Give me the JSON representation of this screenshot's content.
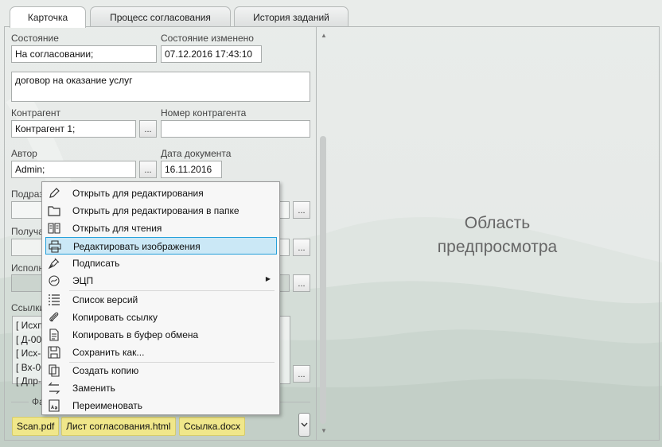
{
  "tabs": [
    {
      "label": "Карточка"
    },
    {
      "label": "Процесс согласования"
    },
    {
      "label": "История заданий"
    }
  ],
  "card": {
    "state": {
      "label": "Состояние",
      "value": "На согласовании;"
    },
    "state_changed": {
      "label": "Состояние изменено",
      "value": "07.12.2016  17:43:10"
    },
    "description": {
      "value": "договор на оказание услуг"
    },
    "counterparty": {
      "label": "Контрагент",
      "value": "Контрагент 1;",
      "button": "..."
    },
    "counterparty_number": {
      "label": "Номер контрагента",
      "value": ""
    },
    "author": {
      "label": "Автор",
      "value": "Admin;",
      "button": "..."
    },
    "document_date": {
      "label": "Дата документа",
      "value": "16.11.2016"
    },
    "department": {
      "label": "Подраз",
      "button": "..."
    },
    "recipient": {
      "label": "Получа",
      "button": "..."
    },
    "executor": {
      "label": "Исполн",
      "button": "..."
    },
    "links": {
      "label": "Ссылки",
      "items": [
        "[ Исхп",
        "[ Д-00",
        "[ Исх-",
        "[ Вх-00",
        "[ Дпр-"
      ],
      "button": "..."
    },
    "files": {
      "label": "Фа",
      "items": [
        "Scan.pdf",
        "Лист согласования.html",
        "Ссылка.docx"
      ]
    }
  },
  "preview": {
    "line1": "Область",
    "line2": "предпросмотра"
  },
  "context_menu": {
    "items": [
      {
        "label": "Открыть для редактирования",
        "icon": "pencil-icon"
      },
      {
        "label": "Открыть для редактирования в папке",
        "icon": "folder-icon"
      },
      {
        "label": "Открыть для чтения",
        "icon": "book-icon"
      },
      {
        "label": "Редактировать изображения",
        "icon": "printer-icon",
        "highlighted": true
      },
      {
        "label": "Подписать",
        "icon": "pen-nib-icon"
      },
      {
        "label": "ЭЦП",
        "icon": "signature-icon",
        "submenu": true
      },
      {
        "label": "Список версий",
        "icon": "list-icon"
      },
      {
        "label": "Копировать ссылку",
        "icon": "paperclip-icon"
      },
      {
        "label": "Копировать в буфер обмена",
        "icon": "document-icon"
      },
      {
        "label": "Сохранить как...",
        "icon": "save-icon"
      },
      {
        "label": "Создать копию",
        "icon": "copy-icon"
      },
      {
        "label": "Заменить",
        "icon": "swap-arrows-icon"
      },
      {
        "label": "Переименовать",
        "icon": "rename-icon"
      }
    ]
  },
  "colors": {
    "highlight": "#cbe8f6",
    "highlight_border": "#26a0da",
    "file_chip": "#f0e78a"
  }
}
